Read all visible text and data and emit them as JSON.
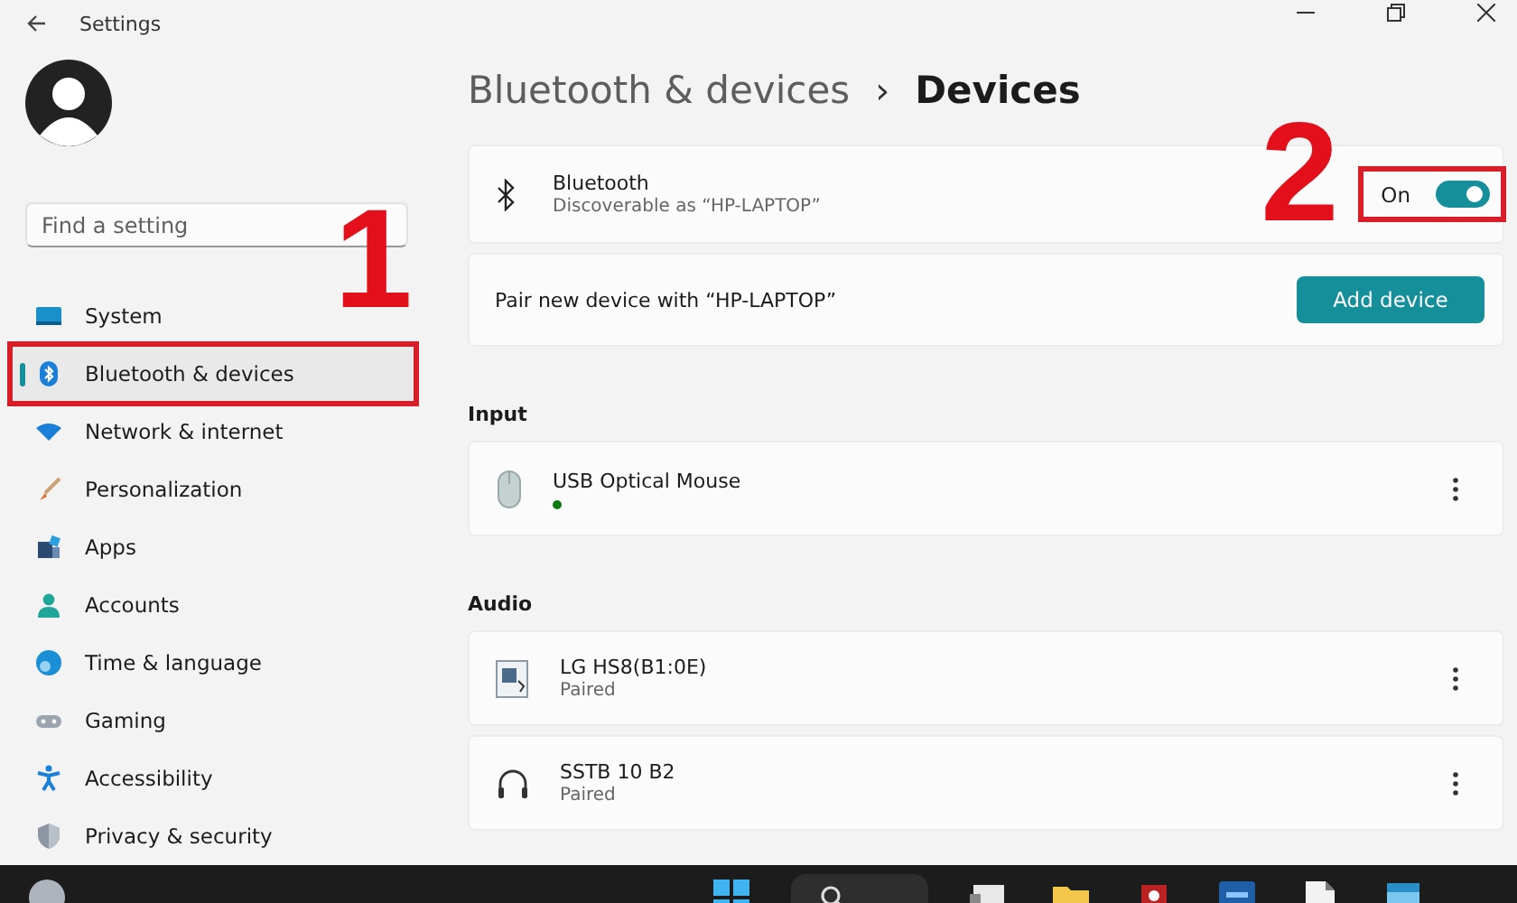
{
  "window": {
    "title": "Settings"
  },
  "sidebar": {
    "search": {
      "placeholder": "Find a setting"
    },
    "items": [
      {
        "label": "System",
        "kind": "system",
        "selected": false,
        "highlighted": false
      },
      {
        "label": "Bluetooth & devices",
        "kind": "bluetooth",
        "selected": true,
        "highlighted": true
      },
      {
        "label": "Network & internet",
        "kind": "wifi",
        "selected": false,
        "highlighted": false
      },
      {
        "label": "Personalization",
        "kind": "brush",
        "selected": false,
        "highlighted": false
      },
      {
        "label": "Apps",
        "kind": "apps",
        "selected": false,
        "highlighted": false
      },
      {
        "label": "Accounts",
        "kind": "person",
        "selected": false,
        "highlighted": false
      },
      {
        "label": "Time & language",
        "kind": "globe",
        "selected": false,
        "highlighted": false
      },
      {
        "label": "Gaming",
        "kind": "gamepad",
        "selected": false,
        "highlighted": false
      },
      {
        "label": "Accessibility",
        "kind": "accessibility",
        "selected": false,
        "highlighted": false
      },
      {
        "label": "Privacy & security",
        "kind": "shield",
        "selected": false,
        "highlighted": false
      }
    ]
  },
  "breadcrumb": {
    "parent": "Bluetooth & devices",
    "separator": "›",
    "current": "Devices"
  },
  "bluetooth": {
    "title": "Bluetooth",
    "subtitle": "Discoverable as “HP-LAPTOP”",
    "toggle_label": "On",
    "on": true,
    "highlighted": true
  },
  "pair": {
    "text": "Pair new device with “HP-LAPTOP”",
    "button": "Add device"
  },
  "sections": [
    {
      "title": "Input",
      "devices": [
        {
          "name": "USB Optical Mouse",
          "kind": "mouse",
          "connected": true
        }
      ]
    },
    {
      "title": "Audio",
      "devices": [
        {
          "name": "LG HS8(B1:0E)",
          "kind": "speaker",
          "status": "Paired",
          "connected": false
        },
        {
          "name": "SSTB 10 B2",
          "kind": "headphones",
          "status": "Paired",
          "connected": false
        }
      ]
    }
  ],
  "annotations": [
    {
      "label": "1"
    },
    {
      "label": "2"
    }
  ],
  "taskbar": {
    "icons": [
      {
        "kind": "start"
      },
      {
        "kind": "search"
      },
      {
        "kind": "window"
      },
      {
        "kind": "folder"
      },
      {
        "kind": "red-app"
      },
      {
        "kind": "ps"
      },
      {
        "kind": "document"
      },
      {
        "kind": "calendar"
      }
    ]
  }
}
